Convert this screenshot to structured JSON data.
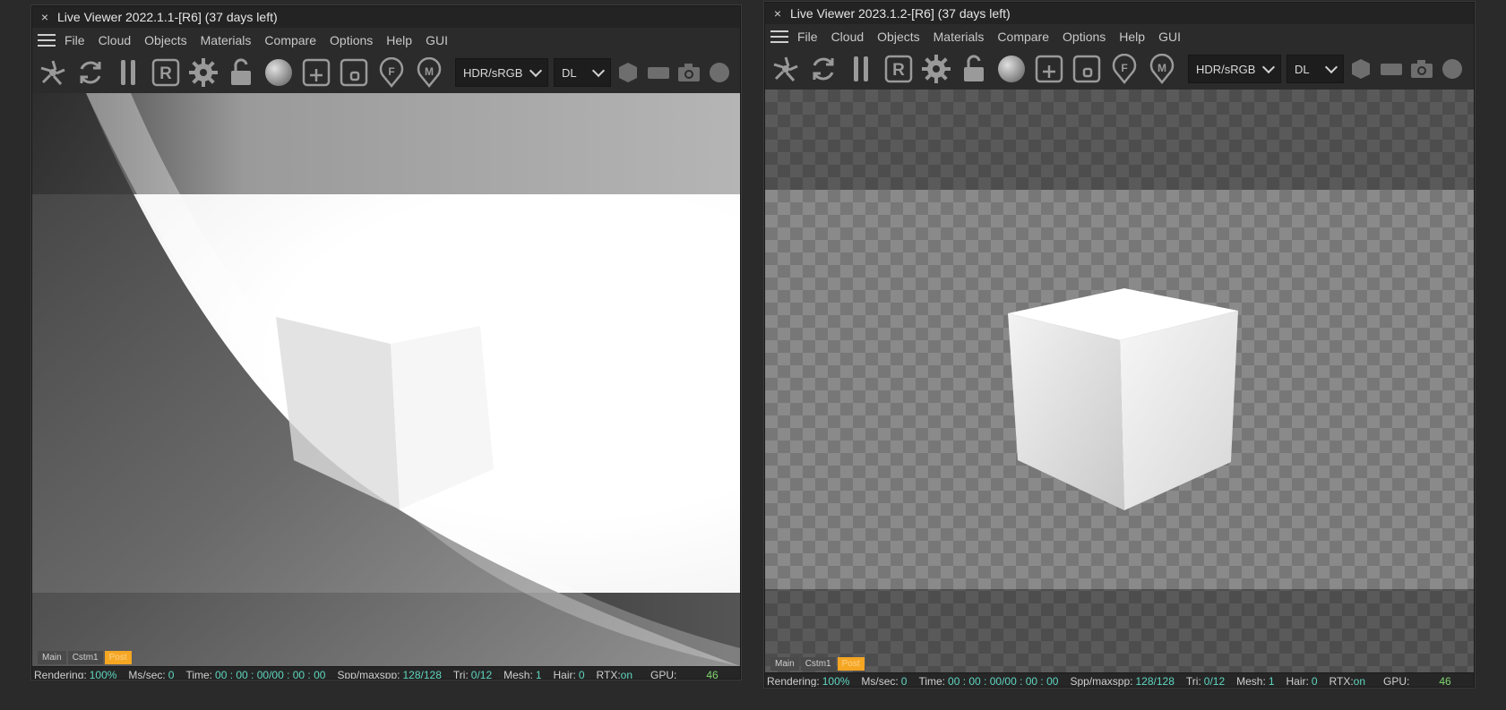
{
  "left_viewer": {
    "title": "Live Viewer 2022.1.1-[R6] (37 days left)",
    "close": "×",
    "menu": [
      "File",
      "Cloud",
      "Objects",
      "Materials",
      "Compare",
      "Options",
      "Help",
      "GUI"
    ],
    "color_mode": "HDR/sRGB",
    "kernel": "DL",
    "tabs": [
      "Main",
      "Cstm1",
      "Post"
    ],
    "active_tab": "Post",
    "status": {
      "rendering_label": "Rendering:",
      "rendering": "100%",
      "mssec_label": "Ms/sec:",
      "mssec": "0",
      "time_label": "Time:",
      "time": "00 : 00 : 00/00 : 00 : 00",
      "spp_label": "Spp/maxspp:",
      "spp": "128/128",
      "tri_label": "Tri:",
      "tri": "0/12",
      "mesh_label": "Mesh:",
      "mesh": "1",
      "hair_label": "Hair:",
      "hair": "0",
      "rtx_label": "RTX:",
      "rtx": "on",
      "gpu_label": "GPU:",
      "gpu": "46"
    }
  },
  "right_viewer": {
    "title": "Live Viewer 2023.1.2-[R6] (37 days left)",
    "close": "×",
    "menu": [
      "File",
      "Cloud",
      "Objects",
      "Materials",
      "Compare",
      "Options",
      "Help",
      "GUI"
    ],
    "color_mode": "HDR/sRGB",
    "kernel": "DL",
    "tabs": [
      "Main",
      "Cstm1",
      "Post"
    ],
    "active_tab": "Post",
    "status": {
      "rendering_label": "Rendering:",
      "rendering": "100%",
      "mssec_label": "Ms/sec:",
      "mssec": "0",
      "time_label": "Time:",
      "time": "00 : 00 : 00/00 : 00 : 00",
      "spp_label": "Spp/maxspp:",
      "spp": "128/128",
      "tri_label": "Tri:",
      "tri": "0/12",
      "mesh_label": "Mesh:",
      "mesh": "1",
      "hair_label": "Hair:",
      "hair": "0",
      "rtx_label": "RTX:",
      "rtx": "on",
      "gpu_label": "GPU:",
      "gpu": "46"
    }
  },
  "toolbar_icons": [
    "send-scene-icon",
    "restart-icon",
    "pause-icon",
    "render-region-icon",
    "settings-gear-icon",
    "lock-icon",
    "material-sphere-icon",
    "add-render-target-icon",
    "focus-pick-icon",
    "focus-marker-icon",
    "material-marker-icon",
    "object-hexagon-icon",
    "rect-icon",
    "camera-icon",
    "circle-icon"
  ],
  "colors": {
    "accent_orange": "#f5a623",
    "status_teal": "#5fd6c0",
    "status_green": "#7fd46e",
    "panel_bg": "#2b2b2b"
  }
}
